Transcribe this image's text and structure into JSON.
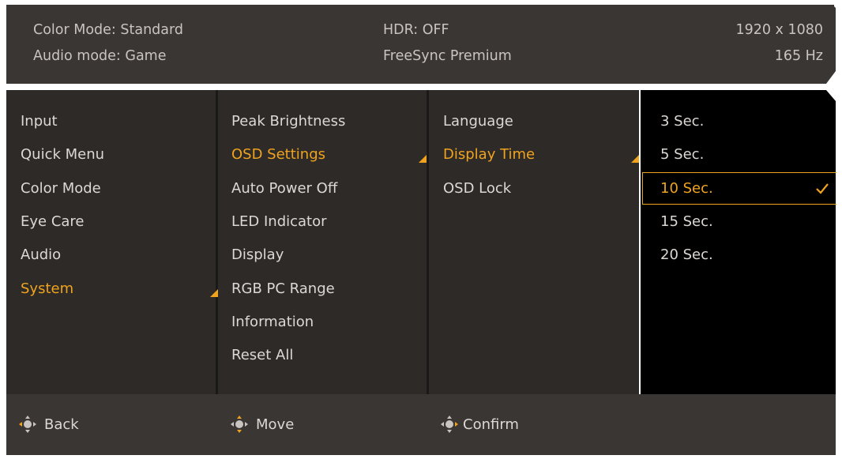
{
  "status": {
    "color_mode": "Color Mode: Standard",
    "audio_mode": "Audio mode: Game",
    "hdr": "HDR: OFF",
    "freesync": "FreeSync Premium",
    "resolution": "1920 x 1080",
    "refresh": "165 Hz"
  },
  "menu": {
    "main": [
      "Input",
      "Quick Menu",
      "Color Mode",
      "Eye Care",
      "Audio",
      "System"
    ],
    "main_selected": "System",
    "system": [
      "Peak Brightness",
      "OSD Settings",
      "Auto Power Off",
      "LED Indicator",
      "Display",
      "RGB PC Range",
      "Information",
      "Reset All"
    ],
    "system_selected": "OSD Settings",
    "osd": [
      "Language",
      "Display Time",
      "OSD Lock"
    ],
    "osd_selected": "Display Time",
    "display_time": [
      "3 Sec.",
      "5 Sec.",
      "10 Sec.",
      "15 Sec.",
      "20 Sec."
    ],
    "display_time_selected": "10 Sec."
  },
  "footer": {
    "back": "Back",
    "move": "Move",
    "confirm": "Confirm"
  },
  "colors": {
    "accent": "#f0a31f",
    "panel": "#2d2a28",
    "bar": "#3a3634"
  },
  "icons": {
    "selected_marker": "triangle-marker-icon",
    "check": "checkmark-icon",
    "nav": "joystick-icon"
  }
}
